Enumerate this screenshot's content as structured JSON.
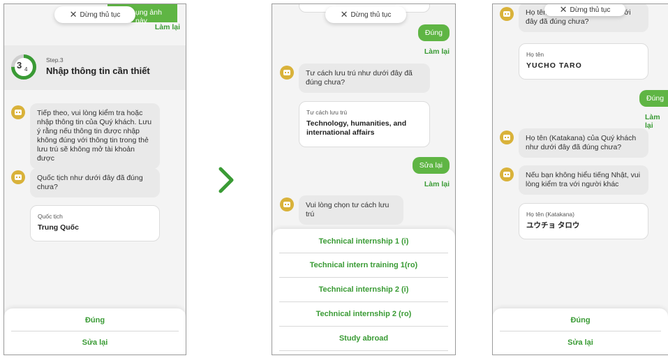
{
  "panel1": {
    "stop_label": "Dừng thủ tục",
    "top_green_partial": "ụng ảnh này",
    "top_redo": "Làm lại",
    "step_fraction_num": "3",
    "step_fraction_den": "4",
    "step_small": "Step.3",
    "step_title": "Nhập thông tin cần thiết",
    "msg1": "Tiếp theo, vui lòng kiểm tra hoặc nhập thông tin của Quý khách. Lưu ý rằng nếu thông tin được nhập không đúng với thông tin trong thẻ lưu trú sẽ không mở tài khoản được",
    "msg2": "Quốc tịch như dưới đây đã đúng chưa?",
    "card_label": "Quốc tịch",
    "card_value": "Trung Quốc",
    "btn_confirm": "Đúng",
    "btn_edit": "Sửa lại"
  },
  "panel2": {
    "stop_label": "Dừng thủ tục",
    "user_reply1": "Đúng",
    "redo1": "Làm lại",
    "msg1": "Tư cách lưu trú như dưới đây đã đúng chưa?",
    "card_label": "Tư cách lưu trú",
    "card_value": "Technology, humanities, and international affairs",
    "user_reply2": "Sửa lại",
    "redo2": "Làm lại",
    "msg2": "Vui lòng chọn tư cách lưu trú",
    "options": [
      "Technical internship 1 (i)",
      "Technical intern training 1(ro)",
      "Technical internship 2 (i)",
      "Technical internship 2 (ro)",
      "Study abroad"
    ]
  },
  "panel3": {
    "stop_label": "Dừng thủ tục",
    "msg0": "Họ tên của Quý khách như dưới đây đã đúng chưa?",
    "card1_label": "Họ tên",
    "card1_value": "YUCHO TARO",
    "user_reply": "Đúng",
    "redo": "Làm lại",
    "msg1": "Họ tên (Katakana) của Quý khách như dưới đây đã đúng chưa?",
    "msg2": "Nếu bạn không hiểu tiếng Nhật, vui lòng kiểm tra với người khác",
    "card2_label": "Họ tên (Katakana)",
    "card2_value": "ユウチョ タロウ",
    "btn_confirm": "Đúng",
    "btn_edit": "Sửa lại"
  },
  "colors": {
    "accent_green": "#3a9b35",
    "bubble_green": "#5fb544",
    "bot_icon": "#d9b23a"
  }
}
